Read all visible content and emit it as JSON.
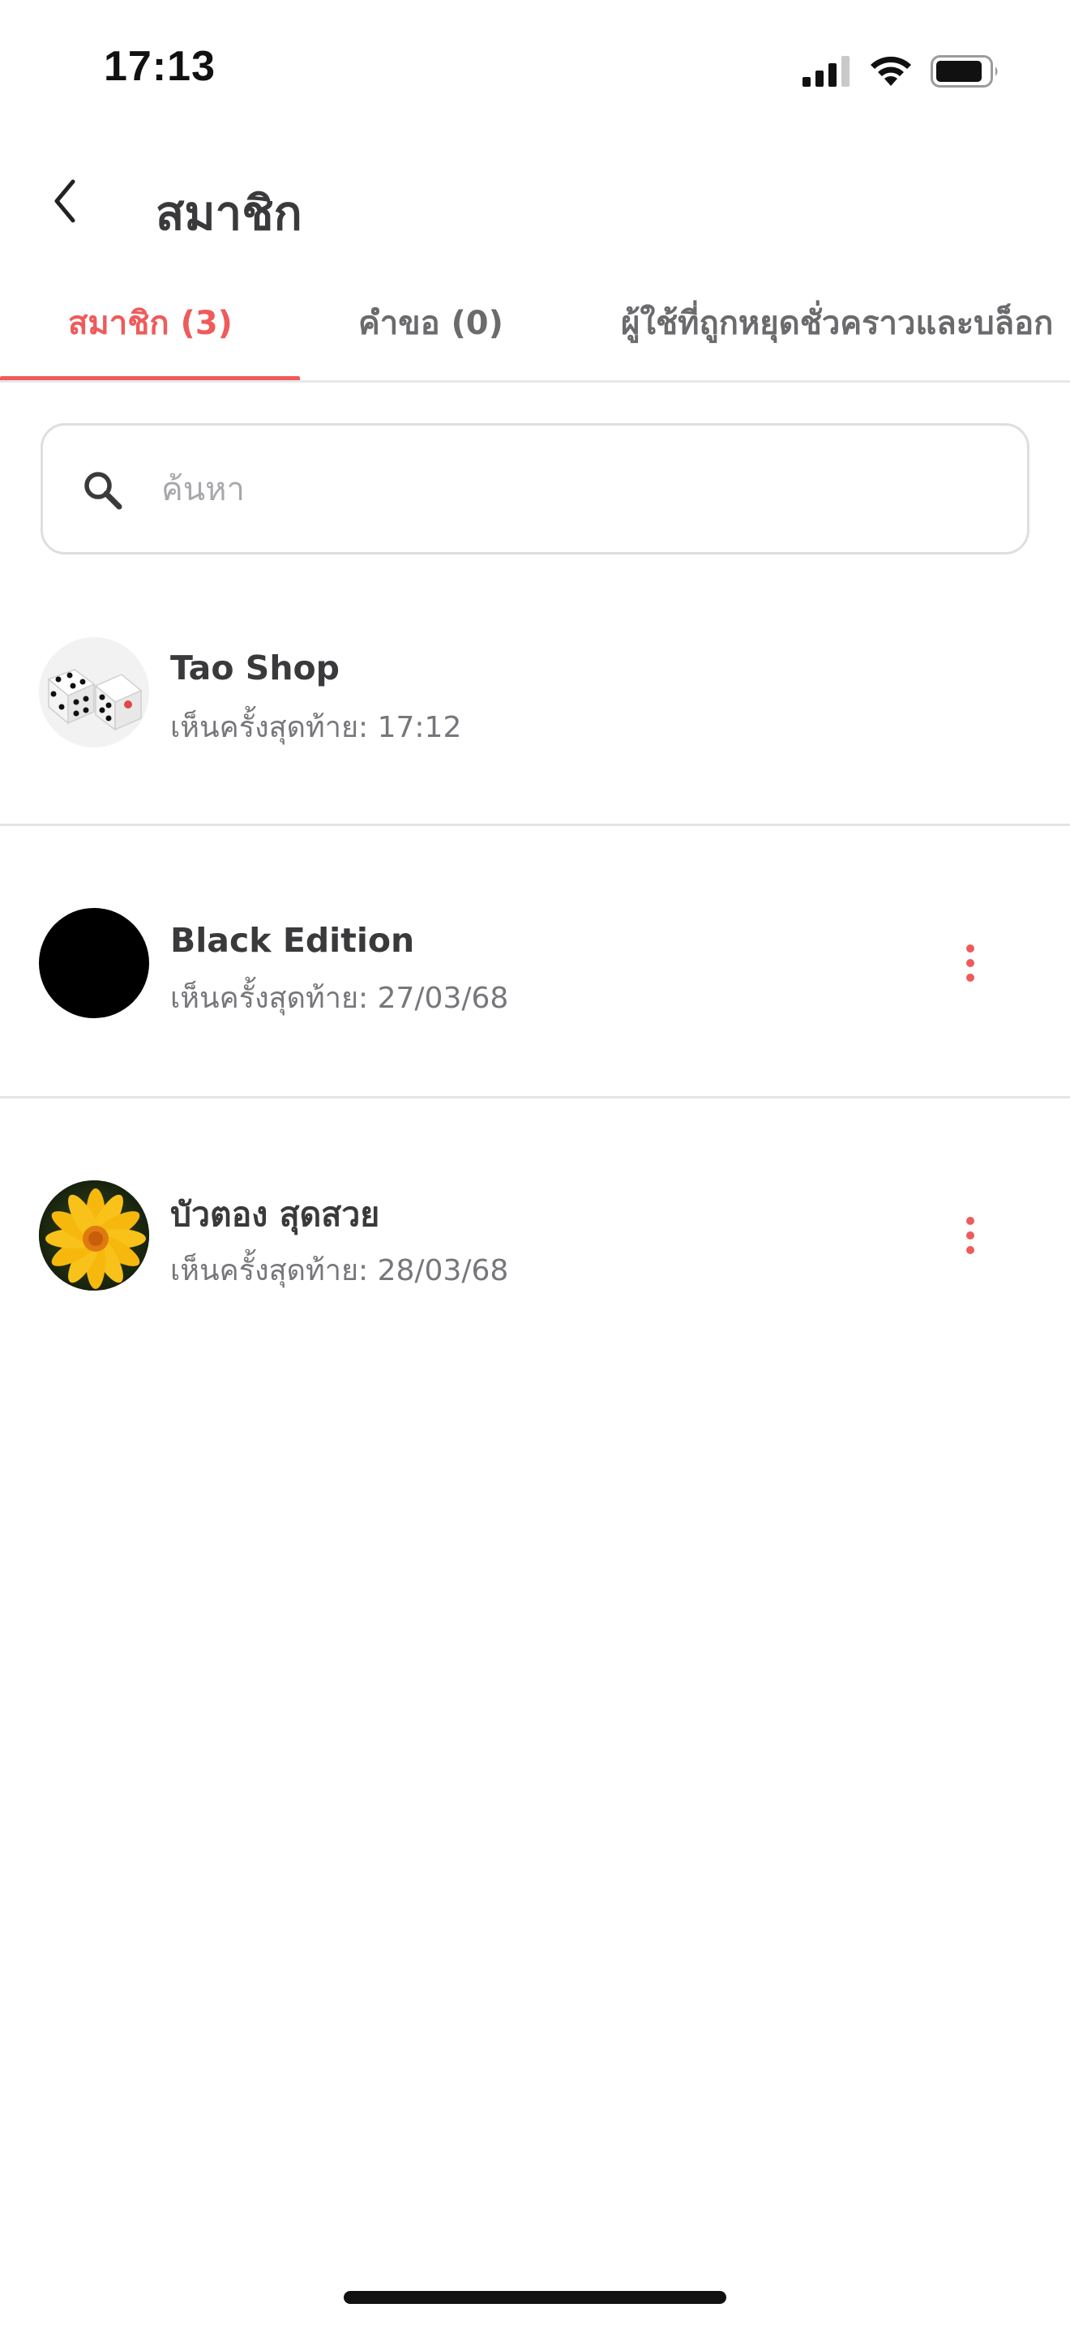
{
  "status_bar": {
    "time": "17:13"
  },
  "header": {
    "back_icon": "chevron-left-icon",
    "title": "สมาชิก"
  },
  "tabs": [
    {
      "label": "สมาชิก (3)",
      "active": true
    },
    {
      "label": "คำขอ (0)",
      "active": false
    },
    {
      "label": "ผู้ใช้ที่ถูกหยุดชั่วคราวและบล็อก",
      "active": false
    }
  ],
  "search": {
    "icon": "search-icon",
    "placeholder": "ค้นหา",
    "value": ""
  },
  "members": [
    {
      "name": "Tao Shop",
      "last_seen": "เห็นครั้งสุดท้าย: 17:12",
      "avatar": "dice-avatar",
      "has_menu": false
    },
    {
      "name": "Black Edition",
      "last_seen": "เห็นครั้งสุดท้าย: 27/03/68",
      "avatar": "black-avatar",
      "has_menu": true
    },
    {
      "name": "บัวตอง สุดสวย",
      "last_seen": "เห็นครั้งสุดท้าย: 28/03/68",
      "avatar": "flower-avatar",
      "has_menu": true
    }
  ],
  "colors": {
    "accent": "#ef5b5b",
    "text_primary": "#3a3a3c",
    "text_secondary": "#77777b",
    "divider": "#e4e4e6"
  }
}
